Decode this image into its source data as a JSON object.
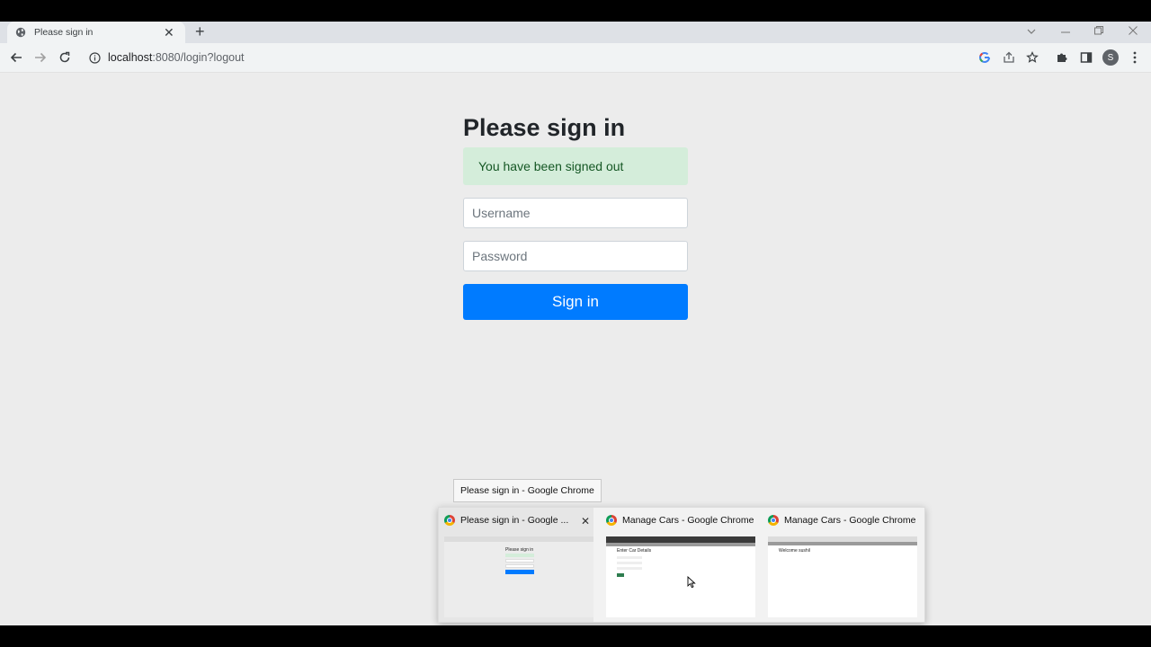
{
  "browser": {
    "tab": {
      "title": "Please sign in",
      "close": "✕"
    },
    "new_tab": "+",
    "url_host": "localhost",
    "url_path": ":8080/login?logout",
    "avatar_letter": "S"
  },
  "page": {
    "heading": "Please sign in",
    "alert": "You have been signed out",
    "username_placeholder": "Username",
    "password_placeholder": "Password",
    "signin_label": "Sign in"
  },
  "taskbar": {
    "tooltip": "Please sign in - Google Chrome",
    "previews": [
      {
        "title": "Please sign in - Google ...",
        "mini_heading": "Please sign in"
      },
      {
        "title": "Manage Cars - Google Chrome",
        "mini_heading": "Enter Car Details"
      },
      {
        "title": "Manage Cars - Google Chrome",
        "mini_heading": "Welcome sushil"
      }
    ],
    "close_glyph": "✕"
  },
  "colors": {
    "primary": "#007bff",
    "alert_bg": "#d4edda",
    "alert_text": "#155724",
    "page_bg": "#ececec"
  }
}
